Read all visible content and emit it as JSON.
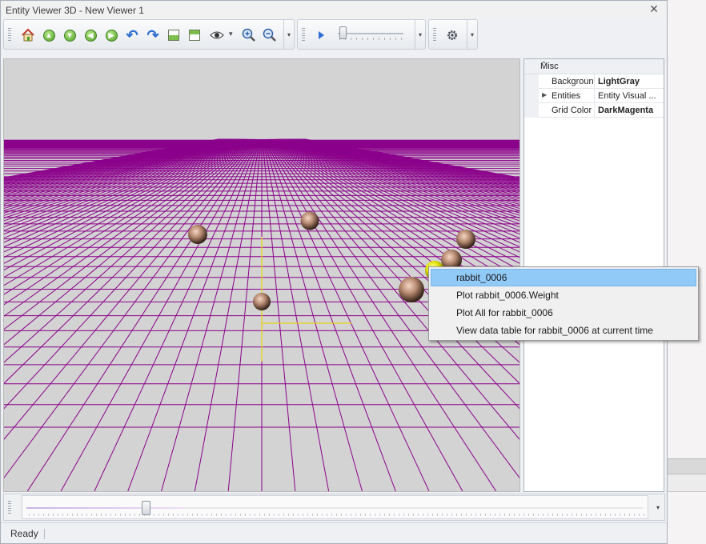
{
  "window": {
    "title": "Entity Viewer 3D - New Viewer 1",
    "close_glyph": "✕"
  },
  "toolbar": {
    "nav_buttons": [
      {
        "name": "home-icon"
      },
      {
        "name": "arrow-up-icon",
        "glyph": "▲"
      },
      {
        "name": "arrow-down-icon",
        "glyph": "▼"
      },
      {
        "name": "arrow-left-icon",
        "glyph": "◀"
      },
      {
        "name": "arrow-right-icon",
        "glyph": "▶"
      },
      {
        "name": "rotate-left-icon",
        "glyph": "↶"
      },
      {
        "name": "rotate-right-icon",
        "glyph": "↷"
      },
      {
        "name": "view-bottom-icon"
      },
      {
        "name": "view-top-icon"
      },
      {
        "name": "eye-icon"
      },
      {
        "name": "zoom-in-icon"
      },
      {
        "name": "zoom-out-icon"
      }
    ],
    "play_icon": "play-icon",
    "settings_icon": "gear-icon",
    "dropdown_glyph": "▾",
    "speed_slider_level": 0.05
  },
  "viewport": {
    "background": "#d3d3d3",
    "grid_color": "#8b008b",
    "axis_color": "#e6d21a",
    "entity_color": "#b98c73",
    "selected_color": "#e0e000"
  },
  "property_grid": {
    "category": "Misc",
    "rows": [
      {
        "name": "Backgrounc",
        "value": "LightGray",
        "bold": true,
        "expandable": false
      },
      {
        "name": "Entities",
        "value": "Entity Visual ...",
        "bold": false,
        "expandable": true
      },
      {
        "name": "Grid Color",
        "value": "DarkMagenta",
        "bold": true,
        "expandable": false
      }
    ]
  },
  "context_menu": {
    "items": [
      {
        "label": "rabbit_0006",
        "highlighted": true
      },
      {
        "label": "Plot rabbit_0006.Weight",
        "highlighted": false
      },
      {
        "label": "Plot All for rabbit_0006",
        "highlighted": false
      },
      {
        "label": "View data table for rabbit_0006 at current time",
        "highlighted": false
      }
    ]
  },
  "time_slider": {
    "level": 0.19
  },
  "status": {
    "text": "Ready"
  }
}
